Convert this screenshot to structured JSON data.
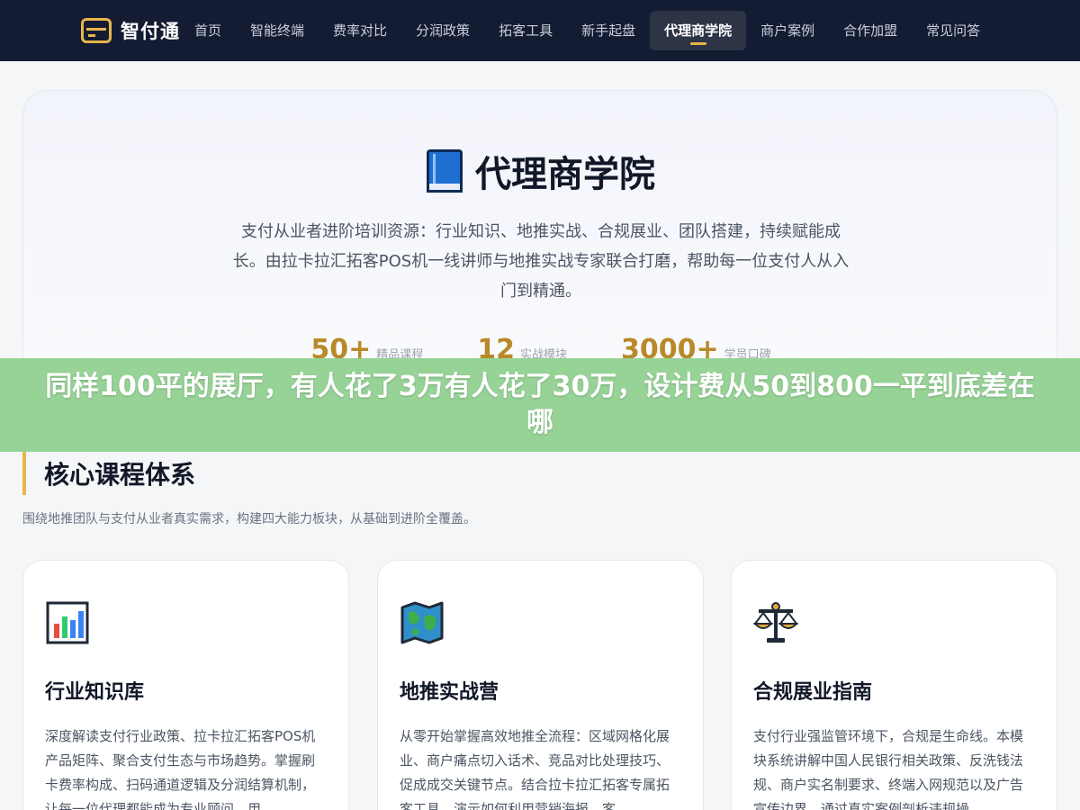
{
  "header": {
    "logo_text": "智付通",
    "nav": [
      {
        "label": "首页"
      },
      {
        "label": "智能终端"
      },
      {
        "label": "费率对比"
      },
      {
        "label": "分润政策"
      },
      {
        "label": "拓客工具"
      },
      {
        "label": "新手起盘"
      },
      {
        "label": "代理商学院",
        "active": true
      },
      {
        "label": "商户案例"
      },
      {
        "label": "合作加盟"
      },
      {
        "label": "常见问答"
      }
    ]
  },
  "hero": {
    "icon": "book-icon",
    "title": "代理商学院",
    "description": "支付从业者进阶培训资源：行业知识、地推实战、合规展业、团队搭建，持续赋能成长。由拉卡拉汇拓客POS机一线讲师与地推实战专家联合打磨，帮助每一位支付人从入门到精通。",
    "stats": [
      {
        "value": "50+",
        "label": "精品课程"
      },
      {
        "value": "12",
        "label": "实战模块"
      },
      {
        "value": "3000+",
        "label": "学员口碑"
      }
    ]
  },
  "overlay": {
    "text": "同样100平的展厅，有人花了3万有人花了30万，设计费从50到800一平到底差在哪"
  },
  "section": {
    "title": "核心课程体系",
    "subtitle": "围绕地推团队与支付从业者真实需求，构建四大能力板块，从基础到进阶全覆盖。"
  },
  "cards": [
    {
      "icon": "bar-chart-icon",
      "title": "行业知识库",
      "text": "深度解读支付行业政策、拉卡拉汇拓客POS机产品矩阵、聚合支付生态与市场趋势。掌握刷卡费率构成、扫码通道逻辑及分润结算机制，让每一位代理都能成为专业顾问，用"
    },
    {
      "icon": "map-icon",
      "title": "地推实战营",
      "text": "从零开始掌握高效地推全流程：区域网格化展业、商户痛点切入话术、竞品对比处理技巧、促成成交关键节点。结合拉卡拉汇拓客专属拓客工具，演示如何利用营销海报、客"
    },
    {
      "icon": "scales-icon",
      "title": "合规展业指南",
      "text": "支付行业强监管环境下，合规是生命线。本模块系统讲解中国人民银行相关政策、反洗钱法规、商户实名制要求、终端入网规范以及广告宣传边界。通过真实案例剖析违规操"
    }
  ],
  "colors": {
    "nav_bg": "#141c33",
    "accent": "#e7b54a",
    "stat": "#b8892a",
    "overlay": "#8ece8e"
  }
}
